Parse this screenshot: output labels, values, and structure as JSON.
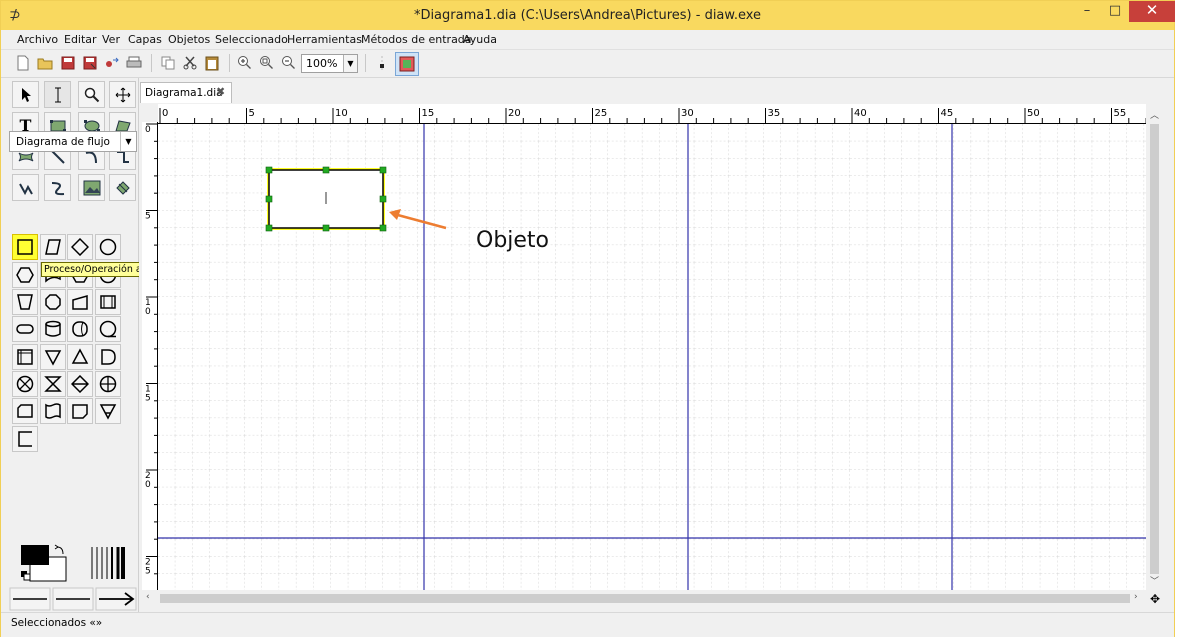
{
  "window": {
    "title": "*Diagrama1.dia (C:\\Users\\Andrea\\Pictures) - diaw.exe",
    "app_icon": "dia-icon",
    "controls": {
      "minimize": "–",
      "maximize": "□",
      "close": "✕"
    }
  },
  "menu": {
    "items": [
      "Archivo",
      "Editar",
      "Ver",
      "Capas",
      "Objetos",
      "Seleccionado",
      "Herramientas",
      "Métodos de entrada",
      "Ayuda"
    ]
  },
  "toolbar": {
    "zoom": "100%",
    "buttons": [
      "new-icon",
      "open-icon",
      "save-icon",
      "save-as-icon",
      "export-icon",
      "print-icon",
      "copy-icon",
      "cut-icon",
      "paste-icon",
      "zoom-in-icon",
      "zoom-fit-icon",
      "zoom-out-icon",
      "grid-icon",
      "snap-icon"
    ]
  },
  "toolbox": {
    "tools": [
      "pointer-icon",
      "text-cursor-icon",
      "magnify-icon",
      "move-icon",
      "text-icon",
      "box-icon",
      "ellipse-icon",
      "polygon-icon",
      "beziergon-icon",
      "line-icon",
      "arc-icon",
      "zigzag-icon",
      "polyline-icon",
      "bezier-icon",
      "image-icon",
      "outline-icon"
    ],
    "sheet": "Diagrama de flujo",
    "tooltip": "Proceso/Operación auxiliar"
  },
  "document": {
    "tab": "Diagrama1.dia",
    "ruler_labels": [
      "0",
      "5",
      "10",
      "15",
      "20",
      "25",
      "30",
      "35",
      "40",
      "45",
      "50",
      "55"
    ],
    "vruler_labels": [
      "0",
      "5",
      "1\n0",
      "1\n5",
      "2\n0",
      "2\n5"
    ]
  },
  "annotation": {
    "label": "Objeto",
    "color": "#ed7d31"
  },
  "status": {
    "text": "Seleccionados «»"
  },
  "colors": {
    "accent_yellow": "#ffff33",
    "page_border": "#3333aa",
    "handle_green": "#22aa22"
  }
}
